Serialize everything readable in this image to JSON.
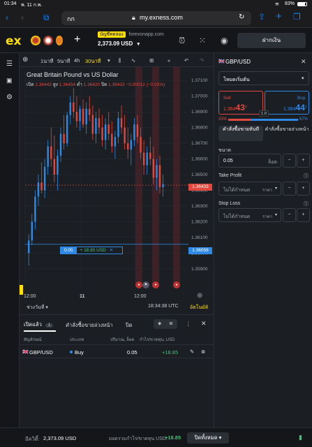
{
  "status": {
    "time": "01:34",
    "date": "พ. 11 ก.พ.",
    "battery": "83%"
  },
  "browser": {
    "aa": "กก",
    "url": "my.exness.com",
    "lock_icon": "lock-icon"
  },
  "header": {
    "logo": "ex",
    "account_type": "บัญชีทดลอง",
    "server": "forexonapp.com",
    "balance": "2,373.09 USD",
    "deposit_label": "ฝากเงิน"
  },
  "toolbar": {
    "tf1": "1นาที",
    "tf2": "5นาที",
    "tf3": "4h",
    "tf4": "30นาที"
  },
  "chart_data": {
    "type": "candlestick",
    "title": "Great Britain Pound vs US Dollar",
    "ohlc_label": {
      "open_label": "เปิด",
      "open": "1.36443",
      "high_label": "สูง",
      "high": "1.36454",
      "low_label": "ต่ำ",
      "low": "1.36420",
      "close_label": "ปิด",
      "close": "1.36433",
      "change": "−0.00012 (−0.01%)"
    },
    "y_ticks": [
      "1.37100",
      "1.37000",
      "1.36900",
      "1.36800",
      "1.36700",
      "1.36600",
      "1.36500",
      "1.36400",
      "1.36300",
      "1.36200",
      "1.36100",
      "1.36000",
      "1.35900"
    ],
    "ylim": [
      1.3585,
      1.3715
    ],
    "x_ticks": [
      "12:00",
      "11",
      "12:00"
    ],
    "current_price": "1.36433",
    "order_line_price": "1.36056",
    "order_line": {
      "volume": "0.05",
      "pnl": "+ 18.85 USD"
    },
    "candles": [
      [
        1.36,
        1.3612,
        1.3592,
        1.3608
      ],
      [
        1.3608,
        1.3625,
        1.3605,
        1.362
      ],
      [
        1.362,
        1.364,
        1.3615,
        1.3636
      ],
      [
        1.3636,
        1.365,
        1.363,
        1.3645
      ],
      [
        1.3645,
        1.3658,
        1.3638,
        1.364
      ],
      [
        1.364,
        1.366,
        1.3635,
        1.3655
      ],
      [
        1.3655,
        1.3672,
        1.365,
        1.3668
      ],
      [
        1.3668,
        1.368,
        1.3655,
        1.366
      ],
      [
        1.366,
        1.3675,
        1.3645,
        1.365
      ],
      [
        1.365,
        1.3666,
        1.364,
        1.3662
      ],
      [
        1.3662,
        1.368,
        1.3658,
        1.3676
      ],
      [
        1.3676,
        1.3688,
        1.3666,
        1.367
      ],
      [
        1.367,
        1.369,
        1.3668,
        1.3688
      ],
      [
        1.3688,
        1.37,
        1.3682,
        1.3696
      ],
      [
        1.3696,
        1.3705,
        1.3686,
        1.369
      ],
      [
        1.369,
        1.37,
        1.368,
        1.3684
      ],
      [
        1.3684,
        1.3694,
        1.3678,
        1.3692
      ],
      [
        1.3692,
        1.3698,
        1.368,
        1.3682
      ],
      [
        1.3682,
        1.3696,
        1.3676,
        1.3692
      ],
      [
        1.3692,
        1.37,
        1.3684,
        1.3688
      ],
      [
        1.3688,
        1.3694,
        1.3672,
        1.3676
      ],
      [
        1.3676,
        1.369,
        1.367,
        1.3686
      ],
      [
        1.3686,
        1.3692,
        1.3676,
        1.368
      ],
      [
        1.368,
        1.3688,
        1.3668,
        1.3672
      ],
      [
        1.3672,
        1.3686,
        1.3666,
        1.3682
      ],
      [
        1.3682,
        1.369,
        1.3672,
        1.3676
      ],
      [
        1.3676,
        1.3684,
        1.3664,
        1.3668
      ],
      [
        1.3668,
        1.3678,
        1.366,
        1.3674
      ],
      [
        1.3674,
        1.369,
        1.367,
        1.3686
      ],
      [
        1.3686,
        1.3694,
        1.3676,
        1.368
      ],
      [
        1.368,
        1.3688,
        1.3666,
        1.367
      ],
      [
        1.367,
        1.368,
        1.366,
        1.3666
      ],
      [
        1.3666,
        1.3676,
        1.3656,
        1.3672
      ],
      [
        1.3672,
        1.3686,
        1.3668,
        1.3682
      ],
      [
        1.3682,
        1.3688,
        1.367,
        1.3674
      ],
      [
        1.3674,
        1.368,
        1.366,
        1.3664
      ],
      [
        1.3664,
        1.3672,
        1.365,
        1.3656
      ],
      [
        1.3656,
        1.3668,
        1.365,
        1.3664
      ],
      [
        1.3664,
        1.3674,
        1.3656,
        1.366
      ],
      [
        1.366,
        1.3668,
        1.3644,
        1.3648
      ],
      [
        1.3648,
        1.366,
        1.364,
        1.3656
      ],
      [
        1.3656,
        1.3662,
        1.3638,
        1.3642
      ],
      [
        1.3642,
        1.365,
        1.3636,
        1.3644
      ]
    ]
  },
  "chart_footer": {
    "range": "ช่วงวันที่",
    "clock": "18:34:38 UTC",
    "auto": "อัตโนมัติ"
  },
  "order_panel": {
    "symbol": "GBP/USD",
    "mode": "โหมดเริ่มต้น",
    "sell_label": "Sell",
    "sell_price_main": "1.364",
    "sell_price_big": "43",
    "sell_price_sup": "3",
    "buy_label": "Buy",
    "buy_price_main": "1.364",
    "buy_price_big": "44",
    "buy_price_sup": "1",
    "spread": "1.0",
    "sell_pct": "33%",
    "buy_pct": "67%",
    "market_tab": "คำสั่งซื้อขายทันที",
    "pending_tab": "คำสั่งซื้อขายล่วงหน้า",
    "volume_label": "ขนาด",
    "volume_value": "0.05",
    "volume_unit": "ล็อต",
    "tp_label": "Take Profit",
    "tp_placeholder": "ไม่ได้กำหนด",
    "tp_unit": "ราคา",
    "sl_label": "Stop Loss",
    "sl_placeholder": "ไม่ได้กำหนด",
    "sl_unit": "ราคา"
  },
  "positions": {
    "tab_open": "เปิดแล้ว",
    "tab_open_count": "1",
    "tab_pending": "คำสั่งซื้อขายล่วงหน้า",
    "tab_closed": "ปิด",
    "columns": [
      "สัญลักษณ์",
      "ประเภท",
      "ปริมาณ, ล็อต",
      "กำไร/ขาดทุน, USD"
    ],
    "rows": [
      {
        "symbol": "GBP/USD",
        "type": "Buy",
        "volume": "0.05",
        "pnl": "+18.85"
      }
    ]
  },
  "footer": {
    "equity_label": "อีควิตี้:",
    "equity": "2,373.09 USD",
    "total_pnl_label": "ยอดรวมกำไร/ขาดทุน USD:",
    "total_pnl": "+18.85",
    "close_all": "ปิดทั้งหมด"
  },
  "colors": {
    "bull": "#2e8ae6",
    "bear": "#e2483d",
    "accent": "#ffde02",
    "buy": "#2e8ae6",
    "sell": "#e2483d"
  }
}
